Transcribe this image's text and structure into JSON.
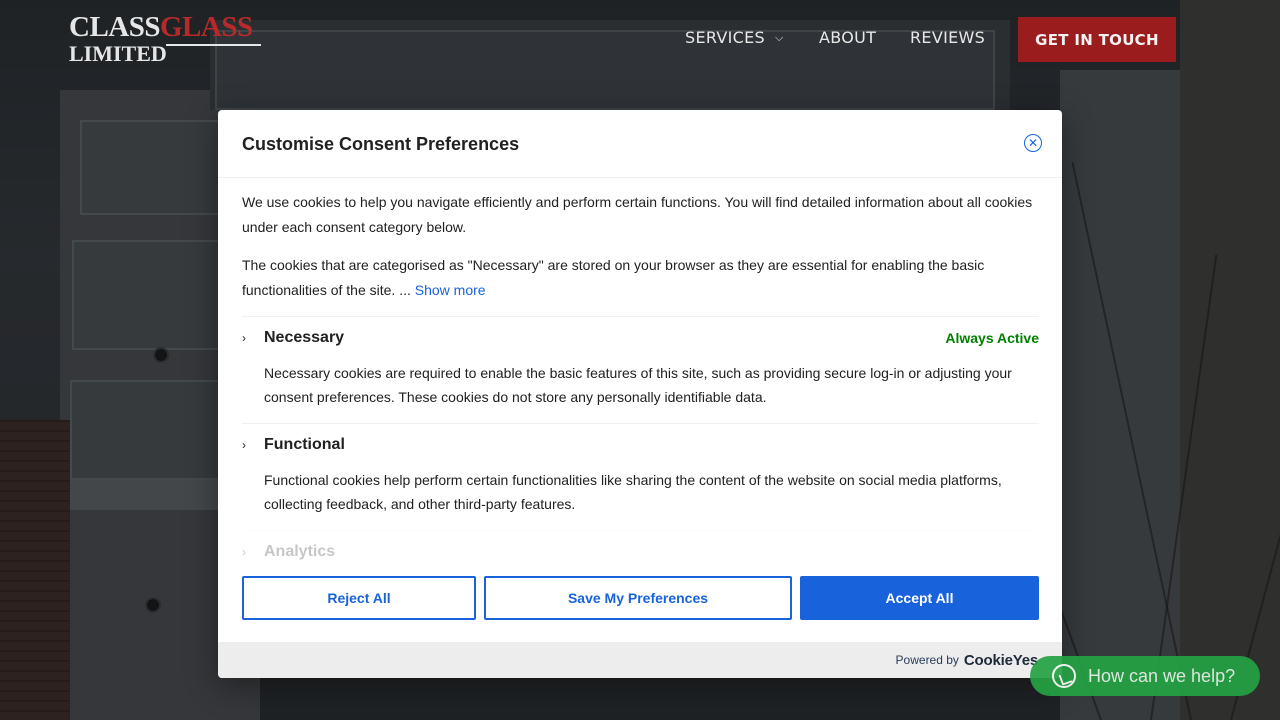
{
  "site": {
    "logo": {
      "word1": "CLASS",
      "word2": "GLASS",
      "word3": "LIMITED"
    },
    "nav": {
      "services": "SERVICES",
      "about": "ABOUT",
      "reviews": "REVIEWS",
      "cta": "GET IN TOUCH"
    }
  },
  "modal": {
    "title": "Customise Consent Preferences",
    "close_symbol": "✕",
    "intro1": "We use cookies to help you navigate efficiently and perform certain functions. You will find detailed information about all cookies under each consent category below.",
    "intro2": "The cookies that are categorised as \"Necessary\" are stored on your browser as they are essential for enabling the basic functionalities of the site. ...",
    "show_more": "Show more",
    "categories": [
      {
        "name": "Necessary",
        "status": "Always Active",
        "description": "Necessary cookies are required to enable the basic features of this site, such as providing secure log-in or adjusting your consent preferences. These cookies do not store any personally identifiable data."
      },
      {
        "name": "Functional",
        "description": "Functional cookies help perform certain functionalities like sharing the content of the website on social media platforms, collecting feedback, and other third-party features."
      },
      {
        "name": "Analytics"
      }
    ],
    "buttons": {
      "reject": "Reject All",
      "save": "Save My Preferences",
      "accept": "Accept All"
    },
    "powered_by": "Powered by",
    "powered_brand": "CookieYes"
  },
  "whatsapp": {
    "label": "How can we help?",
    "icon": "whatsapp-icon"
  },
  "colors": {
    "accent": "#1863dc",
    "brand_red": "#9b1c1c",
    "active_green": "#008000",
    "whatsapp_green": "#25a244"
  }
}
